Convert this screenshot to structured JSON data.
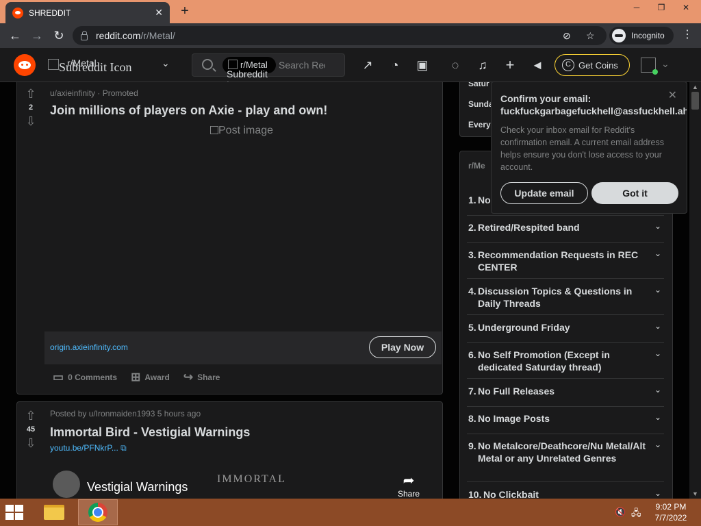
{
  "browser": {
    "tab_title": "SHREDDIT",
    "tab_close": "✕",
    "new_tab": "+",
    "window_controls": [
      "─",
      "❐",
      "✕"
    ],
    "url_host": "reddit.com",
    "url_path": "/r/Metal/",
    "incognito_label": "Incognito"
  },
  "header": {
    "community_icon_alt": "Subreddit Icon",
    "community_name": "r/Metal",
    "search_pill_name": "r/Metal",
    "search_pill_alt": "Subreddit Icon",
    "search_placeholder": "Search Reddit",
    "get_coins": "Get Coins"
  },
  "posts": [
    {
      "author": "u/axieinfinity",
      "promoted": "Promoted",
      "votes": "2",
      "title": "Join millions of players on Axie - play and own!",
      "image_alt": "Post image",
      "ad_domain": "origin.axieinfinity.com",
      "cta": "Play Now",
      "comments": "0 Comments",
      "award": "Award",
      "share": "Share"
    },
    {
      "meta": "Posted by u/Ironmaiden1993 5 hours ago",
      "votes": "45",
      "title": "Immortal Bird - Vestigial Warnings",
      "link": "youtu.be/PFNkrP...",
      "embed_title": "Vestigial Warnings",
      "embed_art": "IMMORTAL",
      "embed_share": "Share"
    }
  ],
  "sidebar": {
    "schedule": [
      "Satur",
      "Sunda",
      "Every"
    ],
    "rules_title": "r/Me",
    "rules": [
      {
        "num": "1.",
        "text": "No"
      },
      {
        "num": "2.",
        "text": "Retired/Respited band"
      },
      {
        "num": "3.",
        "text": "Recommendation Requests in REC CENTER"
      },
      {
        "num": "4.",
        "text": "Discussion Topics & Questions in Daily Threads"
      },
      {
        "num": "5.",
        "text": "Underground Friday"
      },
      {
        "num": "6.",
        "text": "No Self Promotion (Except in dedicated Saturday thread)"
      },
      {
        "num": "7.",
        "text": "No Full Releases"
      },
      {
        "num": "8.",
        "text": "No Image Posts"
      },
      {
        "num": "9.",
        "text": "No Metalcore/Deathcore/Nu Metal/Alt Metal or any Unrelated Genres"
      },
      {
        "num": "10.",
        "text": "No Clickbait"
      }
    ]
  },
  "popover": {
    "title": "Confirm your email:",
    "email": "fuckfuckgarbagefuckhell@assfuckhell.ahshi",
    "body": "Check your inbox email for Reddit's confirmation email. A current email address helps ensure you don't lose access to your account.",
    "update_btn": "Update email",
    "got_it_btn": "Got it"
  },
  "taskbar": {
    "time": "9:02 PM",
    "date": "7/7/2022"
  },
  "colors": {
    "reddit_orange": "#ff4500",
    "link_blue": "#4fbcff",
    "coins_border": "#ffd635",
    "online_green": "#46d160",
    "tabstrip": "#e8966e",
    "taskbar": "#8c4a26"
  }
}
